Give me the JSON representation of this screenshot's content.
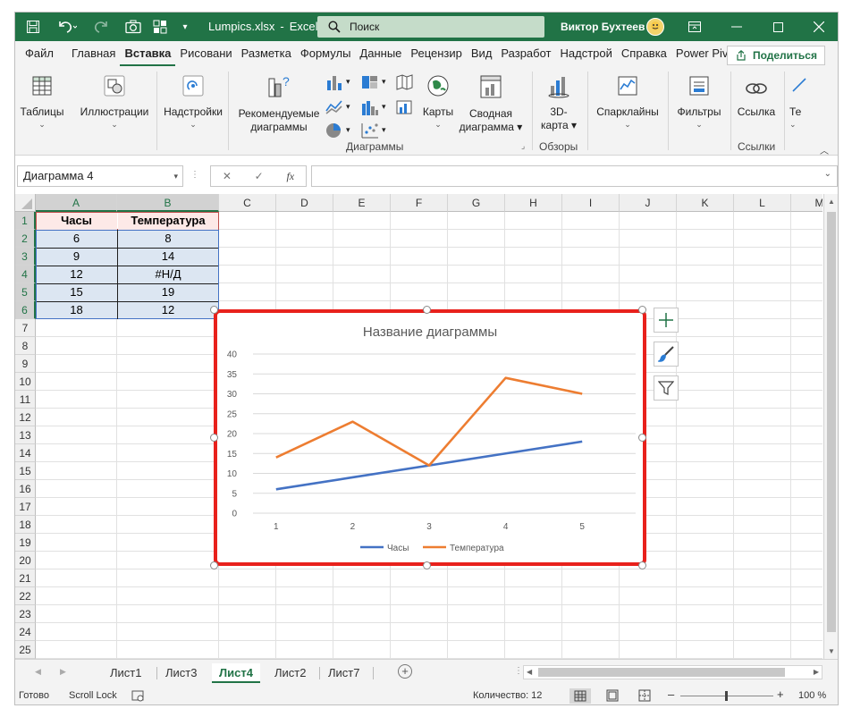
{
  "titlebar": {
    "filename": "Lumpics.xlsx",
    "separator": "-",
    "app": "Excel",
    "search_placeholder": "Поиск",
    "user": "Виктор Бухтеев"
  },
  "tabs": [
    "Файл",
    "Главная",
    "Вставка",
    "Рисовани",
    "Разметка",
    "Формулы",
    "Данные",
    "Рецензир",
    "Вид",
    "Разработ",
    "Надстрой",
    "Справка",
    "Power Piv"
  ],
  "active_tab": "Вставка",
  "share_label": "Поделиться",
  "ribbon": {
    "tables": "Таблицы",
    "illustrations": "Иллюстрации",
    "addins": "Надстройки",
    "recommended_line1": "Рекомендуемые",
    "recommended_line2": "диаграммы",
    "maps": "Карты",
    "pivot_line1": "Сводная",
    "pivot_line2": "диаграмма",
    "map3d_line1": "3D-",
    "map3d_line2": "карта",
    "sparklines": "Спарклайны",
    "filters": "Фильтры",
    "link": "Ссылка",
    "text_truncated": "Те",
    "group_charts": "Диаграммы",
    "group_tours": "Обзоры",
    "group_links": "Ссылки"
  },
  "formula_bar": {
    "name_box": "Диаграмма 4",
    "fx": "fx",
    "formula": ""
  },
  "columns": [
    "A",
    "B",
    "C",
    "D",
    "E",
    "F",
    "G",
    "H",
    "I",
    "J",
    "K",
    "L",
    "M"
  ],
  "rows": [
    "1",
    "2",
    "3",
    "4",
    "5",
    "6",
    "7",
    "8",
    "9",
    "10",
    "11",
    "12",
    "13",
    "14",
    "15",
    "16",
    "17",
    "18",
    "19",
    "20",
    "21",
    "22",
    "23",
    "24",
    "25"
  ],
  "table": {
    "headers": [
      "Часы",
      "Температура"
    ],
    "rows": [
      [
        "6",
        "8"
      ],
      [
        "9",
        "14"
      ],
      [
        "12",
        "#Н/Д"
      ],
      [
        "15",
        "19"
      ],
      [
        "18",
        "12"
      ]
    ]
  },
  "chart_data": {
    "type": "line",
    "title": "Название диаграммы",
    "categories": [
      "1",
      "2",
      "3",
      "4",
      "5"
    ],
    "ylim": [
      0,
      40
    ],
    "yticks": [
      "0",
      "5",
      "10",
      "15",
      "20",
      "25",
      "30",
      "35",
      "40"
    ],
    "grid": true,
    "legend": "bottom",
    "series": [
      {
        "name": "Часы",
        "values": [
          6,
          9,
          12,
          15,
          18
        ],
        "color": "#4472c4"
      },
      {
        "name": "Температура",
        "values": [
          14,
          23,
          12,
          34,
          30
        ],
        "color": "#ed7d31"
      }
    ]
  },
  "sheets": [
    "Лист1",
    "Лист3",
    "Лист4",
    "Лист2",
    "Лист7"
  ],
  "active_sheet": "Лист4",
  "status": {
    "ready": "Готово",
    "scroll_lock": "Scroll Lock",
    "count": "Количество: 12",
    "zoom": "100 %"
  },
  "colors": {
    "excel_green": "#217346",
    "highlight_red": "#e8211c"
  }
}
